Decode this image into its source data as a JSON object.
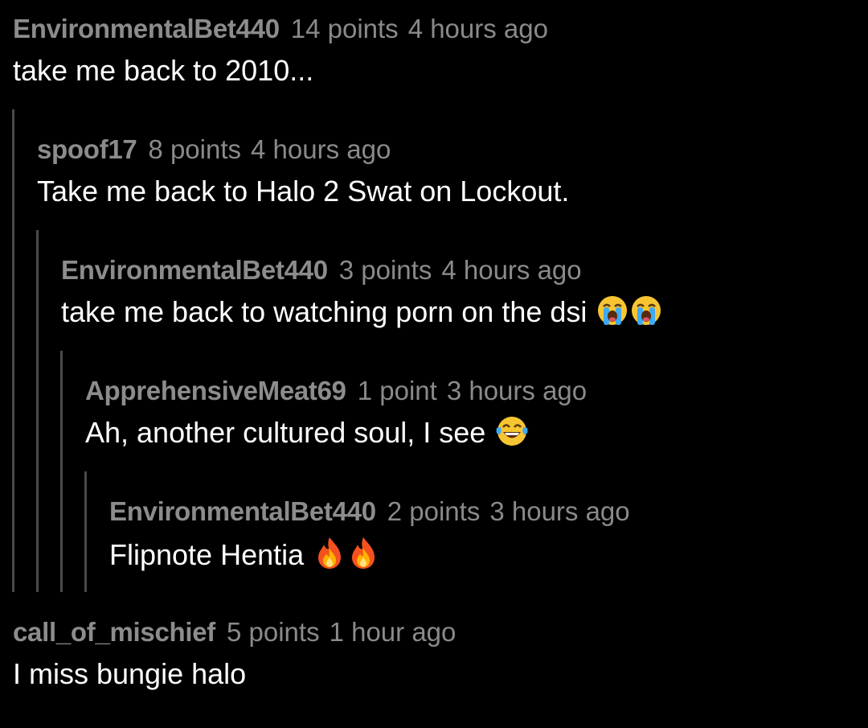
{
  "thread": {
    "comments": [
      {
        "author": "EnvironmentalBet440",
        "points": "14 points",
        "time": "4 hours ago",
        "text": "take me back to 2010..."
      },
      {
        "author": "spoof17",
        "points": "8 points",
        "time": "4 hours ago",
        "text": "Take me back to Halo 2 Swat on Lockout."
      },
      {
        "author": "EnvironmentalBet440",
        "points": "3 points",
        "time": "4 hours ago",
        "text": "take me back to watching porn on the dsi",
        "emojis": [
          "loudly-crying-face",
          "loudly-crying-face"
        ]
      },
      {
        "author": "ApprehensiveMeat69",
        "points": "1 point",
        "time": "3 hours ago",
        "text": "Ah, another cultured soul, I see",
        "emojis": [
          "face-with-tears-of-joy"
        ]
      },
      {
        "author": "EnvironmentalBet440",
        "points": "2 points",
        "time": "3 hours ago",
        "text": "Flipnote Hentia",
        "emojis": [
          "fire",
          "fire"
        ]
      },
      {
        "author": "call_of_mischief",
        "points": "5 points",
        "time": "1 hour ago",
        "text": "I miss bungie halo"
      }
    ]
  },
  "colors": {
    "background": "#000000",
    "meta_text": "#8a8a8a",
    "body_text": "#ffffff",
    "thread_line": "#4a4a4a"
  }
}
